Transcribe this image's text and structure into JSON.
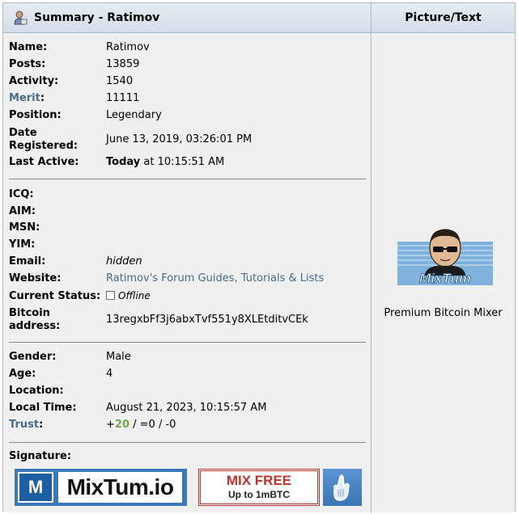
{
  "header": {
    "summary_title": "Summary - Ratimov",
    "picture_title": "Picture/Text"
  },
  "profile": {
    "name_label": "Name:",
    "name": "Ratimov",
    "posts_label": "Posts:",
    "posts": "13859",
    "activity_label": "Activity:",
    "activity": "1540",
    "merit_label": "Merit",
    "merit_colon": ":",
    "merit": "11111",
    "position_label": "Position:",
    "position": "Legendary",
    "date_registered_label": "Date Registered:",
    "date_registered": "June 13, 2019, 03:26:01 PM",
    "last_active_label": "Last Active:",
    "last_active_day": "Today",
    "last_active_time": " at 10:15:51 AM"
  },
  "contact": {
    "icq_label": "ICQ:",
    "aim_label": "AIM:",
    "msn_label": "MSN:",
    "yim_label": "YIM:",
    "email_label": "Email:",
    "email": "hidden",
    "website_label": "Website:",
    "website": "Ratimov's Forum Guides, Tutorials & Lists",
    "status_label": "Current Status:",
    "status": "Offline",
    "bitcoin_label": "Bitcoin address:",
    "bitcoin_address": "13regxbFf3j6abxTvf551y8XLEtditvCEk"
  },
  "personal": {
    "gender_label": "Gender:",
    "gender": "Male",
    "age_label": "Age:",
    "age": "4",
    "location_label": "Location:",
    "local_time_label": "Local Time:",
    "local_time": "August 21, 2023, 10:15:57 AM",
    "trust_label": "Trust",
    "trust_colon": ":",
    "trust_plus": "+",
    "trust_positive": "20",
    "trust_rest": " / =0 / -0"
  },
  "signature": {
    "label": "Signature:",
    "banner_letter": "M",
    "banner_text": "MixTum.io",
    "free_line1": "MIX FREE",
    "free_line2": "Up to 1mBTC"
  },
  "picture": {
    "avatar_text": "MixTum",
    "personal_text": "Premium Bitcoin Mixer"
  },
  "colors": {
    "link": "#476c8e",
    "trust_positive": "#6fa84a",
    "header_bg": "#dce3ec",
    "panel_bg": "#f0f0f0"
  }
}
